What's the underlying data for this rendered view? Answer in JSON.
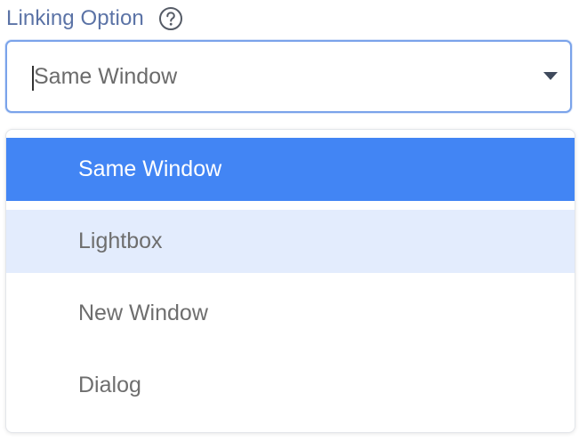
{
  "field": {
    "label": "Linking Option"
  },
  "select": {
    "value": "Same Window"
  },
  "menu": {
    "options": [
      {
        "label": "Same Window",
        "state": "selected"
      },
      {
        "label": "Lightbox",
        "state": "hovered"
      },
      {
        "label": "New Window",
        "state": "normal"
      },
      {
        "label": "Dialog",
        "state": "normal"
      }
    ]
  },
  "colors": {
    "label": "#5b73a6",
    "focus_border": "#7aa3ea",
    "selected_bg": "#4285f4",
    "hover_bg": "#e3ecfd"
  },
  "icons": {
    "help": "question-circle-icon",
    "arrow": "chevron-down-icon"
  }
}
